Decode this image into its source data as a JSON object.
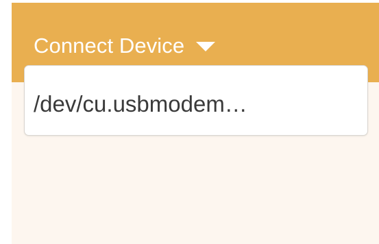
{
  "header": {
    "title": "Connect Device",
    "caret_icon": "triangle-down-icon",
    "background_color": "#e9af50",
    "text_color": "#ffffff"
  },
  "device_list": {
    "items": [
      {
        "label": "/dev/cu.usbmodem…"
      }
    ]
  },
  "panel": {
    "background_color": "#fdf6ef"
  }
}
